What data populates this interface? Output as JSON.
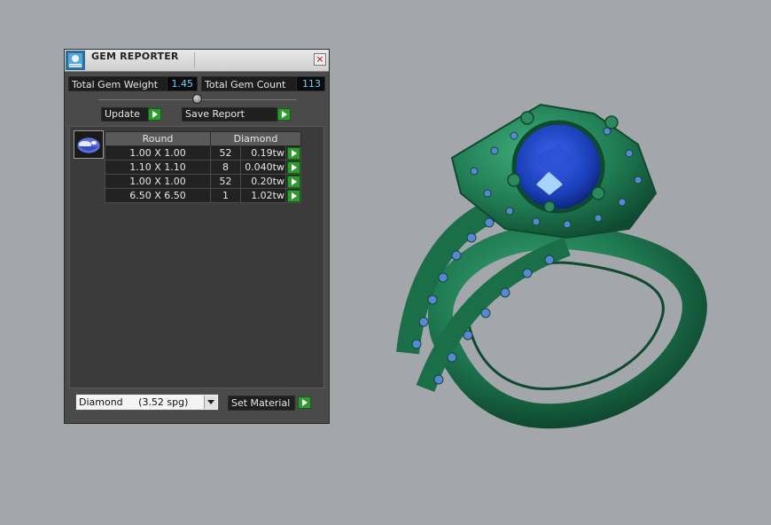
{
  "window": {
    "title": "GEM REPORTER"
  },
  "totals": {
    "weight_label": "Total Gem Weight",
    "weight_value": "1.45",
    "count_label": "Total Gem Count",
    "count_value": "113"
  },
  "actions": {
    "update_label": "Update",
    "save_label": "Save Report"
  },
  "table": {
    "headers": [
      "Round",
      "Diamond"
    ],
    "rows": [
      {
        "size": "1.00 X 1.00",
        "count": "52",
        "weight": "0.19tw"
      },
      {
        "size": "1.10 X 1.10",
        "count": "8",
        "weight": "0.040tw"
      },
      {
        "size": "1.00 X 1.00",
        "count": "52",
        "weight": "0.20tw"
      },
      {
        "size": "6.50 X 6.50",
        "count": "1",
        "weight": "1.02tw"
      }
    ]
  },
  "material": {
    "selected": "Diamond     (3.52 spg)",
    "set_label": "Set Material"
  },
  "colors": {
    "ring_metal": "#1f7a52",
    "gem_center": "#1a3fb8",
    "accent_play": "#2f9a2f"
  }
}
